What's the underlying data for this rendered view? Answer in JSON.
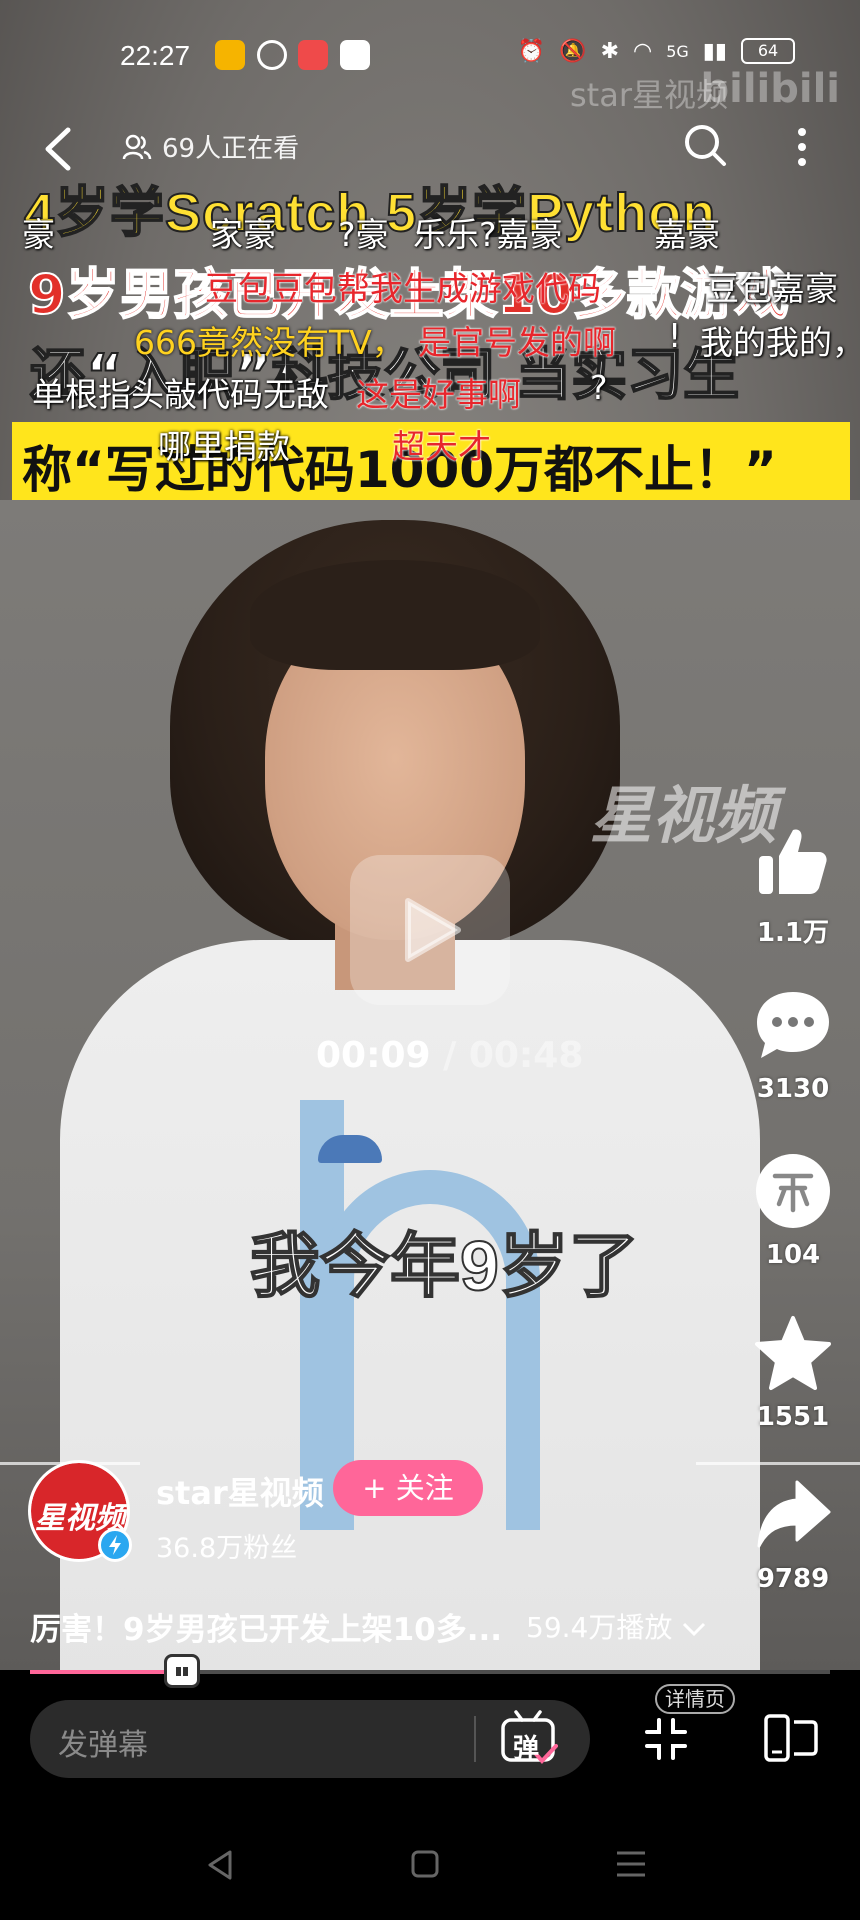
{
  "status_bar": {
    "time": "22:27",
    "network": "5G",
    "battery": "64",
    "watermark": "bilibili",
    "channel_watermark": "star星视频"
  },
  "top_bar": {
    "viewers": "69人正在看"
  },
  "banner": {
    "line1": "4岁学Scratch 5岁学Python",
    "line2": "9岁男孩已开发上架10多款游戏",
    "line3": "还“入职”科技公司 当实习生",
    "line4": "称“写过的代码1000万都不止！”"
  },
  "danmaku": [
    {
      "text": "豪",
      "color": "white"
    },
    {
      "text": "家豪",
      "color": "white"
    },
    {
      "text": "?豪",
      "color": "white"
    },
    {
      "text": "乐乐?嘉豪",
      "color": "white"
    },
    {
      "text": "嘉豪",
      "color": "white"
    },
    {
      "text": "豆包豆包帮我生成游戏代码",
      "color": "red"
    },
    {
      "text": "豆包嘉豪",
      "color": "white"
    },
    {
      "text": "666竟然没有TV，",
      "color": "yellow"
    },
    {
      "text": "是官号发的啊",
      "color": "red"
    },
    {
      "text": "!",
      "color": "white"
    },
    {
      "text": "我的我的，",
      "color": "white"
    },
    {
      "text": "单根指头敲代码无敌",
      "color": "white"
    },
    {
      "text": "这是好事啊",
      "color": "red"
    },
    {
      "text": "?",
      "color": "white"
    },
    {
      "text": "哪里捐款",
      "color": "white"
    },
    {
      "text": "超天才",
      "color": "red"
    }
  ],
  "video": {
    "watermark": "星视频",
    "current_time": "00:09",
    "separator": " / ",
    "total_time": "00:48",
    "subtitle": "我今年9岁了",
    "progress_fraction": 0.19
  },
  "actions": {
    "likes": "1.1万",
    "comments": "3130",
    "coins": "104",
    "favorites": "1551",
    "shares": "9789"
  },
  "author": {
    "name": "star星视频",
    "avatar_text": "星视频",
    "fans": "36.8万粉丝",
    "follow_label": "+ 关注",
    "follow_color": "#ff6699"
  },
  "description": {
    "title": "厉害！9岁男孩已开发上架10多...",
    "plays": "59.4万播放"
  },
  "bottom": {
    "danmaku_placeholder": "发弹幕",
    "danmaku_toggle": "弹",
    "details_label": "详情页"
  },
  "colors": {
    "accent": "#ff6699",
    "banner_yellow": "#ffe51c"
  }
}
